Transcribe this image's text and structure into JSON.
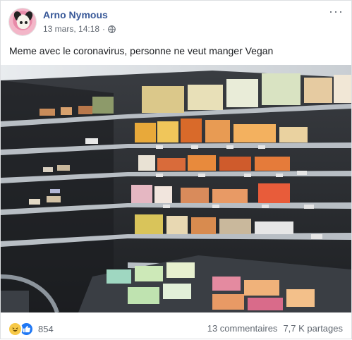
{
  "post": {
    "author": "Arno Nymous",
    "date": "13 mars, 14:18",
    "separator": "·",
    "more_label": "···",
    "text": "Meme avec le coronavirus, personne ne veut manger Vegan"
  },
  "footer": {
    "reaction_count": "854",
    "comments": "13 commentaires",
    "shares": "7,7 K partages"
  },
  "icons": {
    "privacy": "globe-icon",
    "reaction1": "haha-icon",
    "reaction2": "like-icon",
    "more": "more-options-icon"
  },
  "colors": {
    "author_link": "#385898",
    "meta_gray": "#606770",
    "like_blue": "#2078f4",
    "haha_yellow": "#f7c948"
  }
}
